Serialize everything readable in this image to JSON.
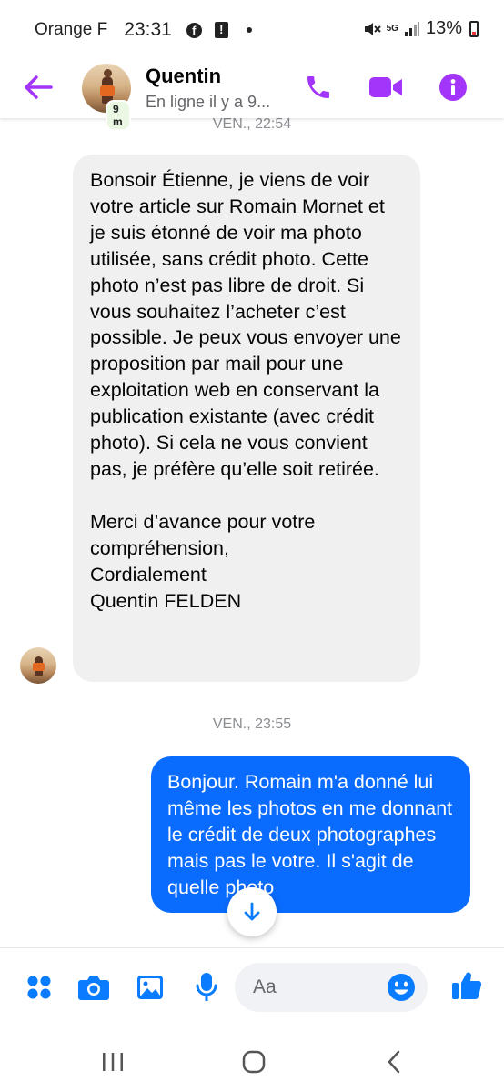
{
  "status_bar": {
    "carrier": "Orange F",
    "time": "23:31",
    "network": "5G",
    "battery": "13%"
  },
  "header": {
    "contact_name": "Quentin",
    "presence_badge": "9 m",
    "status": "En ligne il y a 9...",
    "accent_color": "#a334fa"
  },
  "conversation": {
    "timestamp_top": "VEN., 22:54",
    "incoming_message": "Bonsoir Étienne, je viens de voir votre article sur Romain Mornet et je suis étonné de voir ma photo utilisée, sans crédit photo. Cette photo n’est pas libre de droit. Si vous souhaitez l’acheter c’est possible. Je peux vous envoyer une proposition par mail pour une exploitation web en conservant la publication existante (avec crédit photo). Si cela ne vous convient pas, je préfère qu’elle soit retirée.\n\nMerci d’avance pour votre compréhension,\nCordialement\nQuentin FELDEN",
    "timestamp_mid": "VEN., 23:55",
    "outgoing_message": "Bonjour. Romain m'a donné lui même les photos en me donnant le crédit de deux photographes mais pas le votre. Il s'agit de quelle photo",
    "outgoing_color": "#0a6cff"
  },
  "composer": {
    "placeholder": "Aa",
    "icon_color": "#0a7cff"
  },
  "icons": {
    "back": "arrow-left-icon",
    "call": "phone-icon",
    "video": "video-camera-icon",
    "info": "info-icon",
    "menu": "four-dots-icon",
    "camera": "camera-icon",
    "gallery": "image-icon",
    "mic": "microphone-icon",
    "emoji": "smiley-icon",
    "like": "thumbs-up-icon",
    "scroll": "arrow-down-icon"
  }
}
